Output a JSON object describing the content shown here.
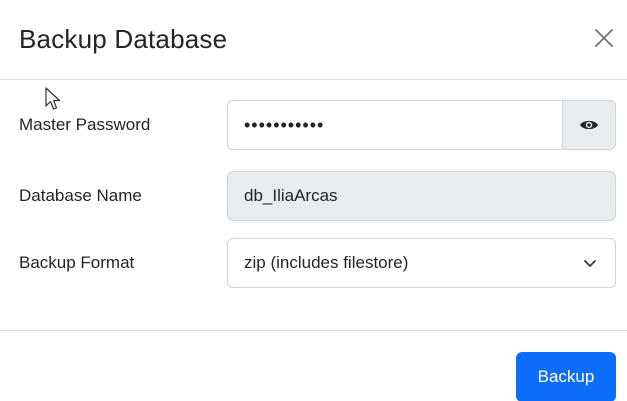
{
  "dialog": {
    "title": "Backup Database",
    "close_label": "×"
  },
  "form": {
    "master_password": {
      "label": "Master Password",
      "value": "•••••••••••",
      "toggle_icon": "eye-icon"
    },
    "database_name": {
      "label": "Database Name",
      "value": "db_IliaArcas"
    },
    "backup_format": {
      "label": "Backup Format",
      "value": "zip (includes filestore)",
      "dropdown_icon": "chevron-down-icon"
    }
  },
  "footer": {
    "backup_label": "Backup"
  },
  "colors": {
    "primary": "#0d6efd",
    "border": "#ced4da",
    "readonly_bg": "#e9ecef",
    "text": "#212529"
  }
}
